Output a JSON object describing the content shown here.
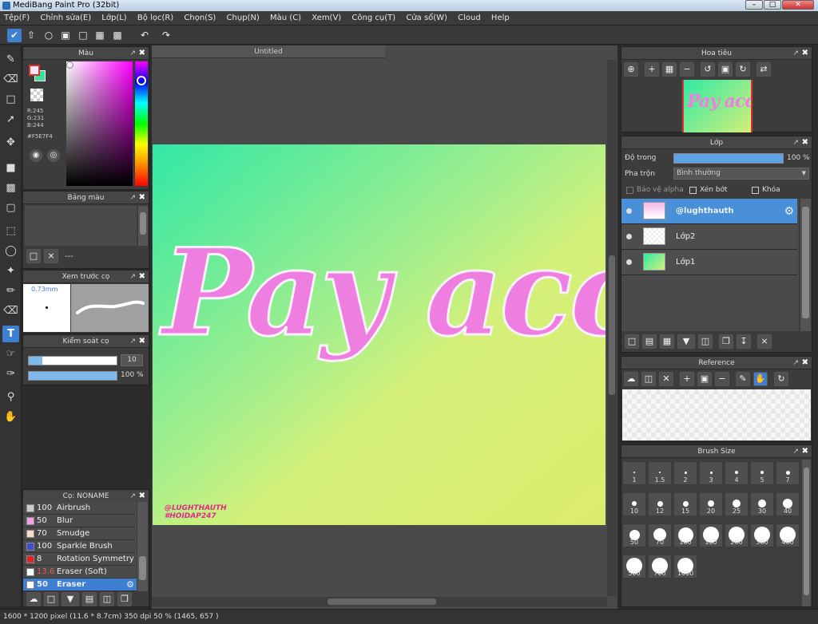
{
  "window": {
    "title": "MediBang Paint Pro (32bit)",
    "min": "–",
    "max": "□",
    "close": "✕"
  },
  "menu": [
    "Tệp(F)",
    "Chỉnh sửa(E)",
    "Lớp(L)",
    "Bộ lọc(R)",
    "Chọn(S)",
    "Chụp(N)",
    "Màu (C)",
    "Xem(V)",
    "Công cụ(T)",
    "Cửa sổ(W)",
    "Cloud",
    "Help"
  ],
  "doc_tab": "Untitled",
  "color_panel": {
    "title": "Màu",
    "r": "R:245",
    "g": "G:231",
    "b": "B:244",
    "hex": "#F5E7F4"
  },
  "palette_panel": {
    "title": "Bảng màu",
    "dashes": "---"
  },
  "brush_preview": {
    "title": "Xem trước cọ",
    "size": "0.73mm"
  },
  "brush_control": {
    "title": "Kiểm soát cọ",
    "size_value": "10",
    "opacity_value": "100 %",
    "size_fraction": 0.15,
    "opacity_fraction": 1.0
  },
  "brush_list": {
    "title": "Cọ: NONAME",
    "items": [
      {
        "value": "100",
        "name": "Airbrush",
        "color": "#cccccc"
      },
      {
        "value": "50",
        "name": "Blur",
        "color": "#f0a0e8"
      },
      {
        "value": "70",
        "name": "Smudge",
        "color": "#f5dcc8"
      },
      {
        "value": "100",
        "name": "Sparkle Brush",
        "color": "#3b4fd8"
      },
      {
        "value": "8",
        "name": "Rotation Symmetry Pe",
        "color": "#e02424"
      },
      {
        "value": "13.6",
        "name": "Eraser (Soft)",
        "color": "#ffffff"
      },
      {
        "value": "50",
        "name": "Eraser",
        "color": "#ffffff"
      }
    ]
  },
  "navigator": {
    "title": "Hoa tiêu"
  },
  "layers": {
    "title": "Lớp",
    "opacity_label": "Độ trong",
    "opacity_value": "100 %",
    "opacity_fraction": 1.0,
    "blend_label": "Pha trộn",
    "blend_value": "Bình thường",
    "protect_alpha": "Bảo vệ alpha",
    "clipping": "Xén bớt",
    "lock": "Khóa",
    "items": [
      {
        "name": "@lughthauth",
        "selected": true
      },
      {
        "name": "Lớp2",
        "selected": false
      },
      {
        "name": "Lớp1",
        "selected": false
      }
    ]
  },
  "reference": {
    "title": "Reference"
  },
  "brush_size": {
    "title": "Brush Size",
    "sizes": [
      "1",
      "1.5",
      "2",
      "3",
      "4",
      "5",
      "7",
      "10",
      "12",
      "15",
      "20",
      "25",
      "30",
      "40",
      "50",
      "70",
      "100",
      "150",
      "200",
      "300",
      "400",
      "500",
      "700",
      "1000"
    ]
  },
  "canvas": {
    "main_text": "Pay acc",
    "watermark1": "@LUGHTHAUTH",
    "watermark2": "#HOIDAP247",
    "nav_text": "Pay acc"
  },
  "status": {
    "dimensions": "1600 * 1200 pixel",
    "physical": "(11.6 * 8.7cm)",
    "dpi": "350 dpi",
    "zoom": "50 %",
    "coords": "(1465, 657 )"
  }
}
